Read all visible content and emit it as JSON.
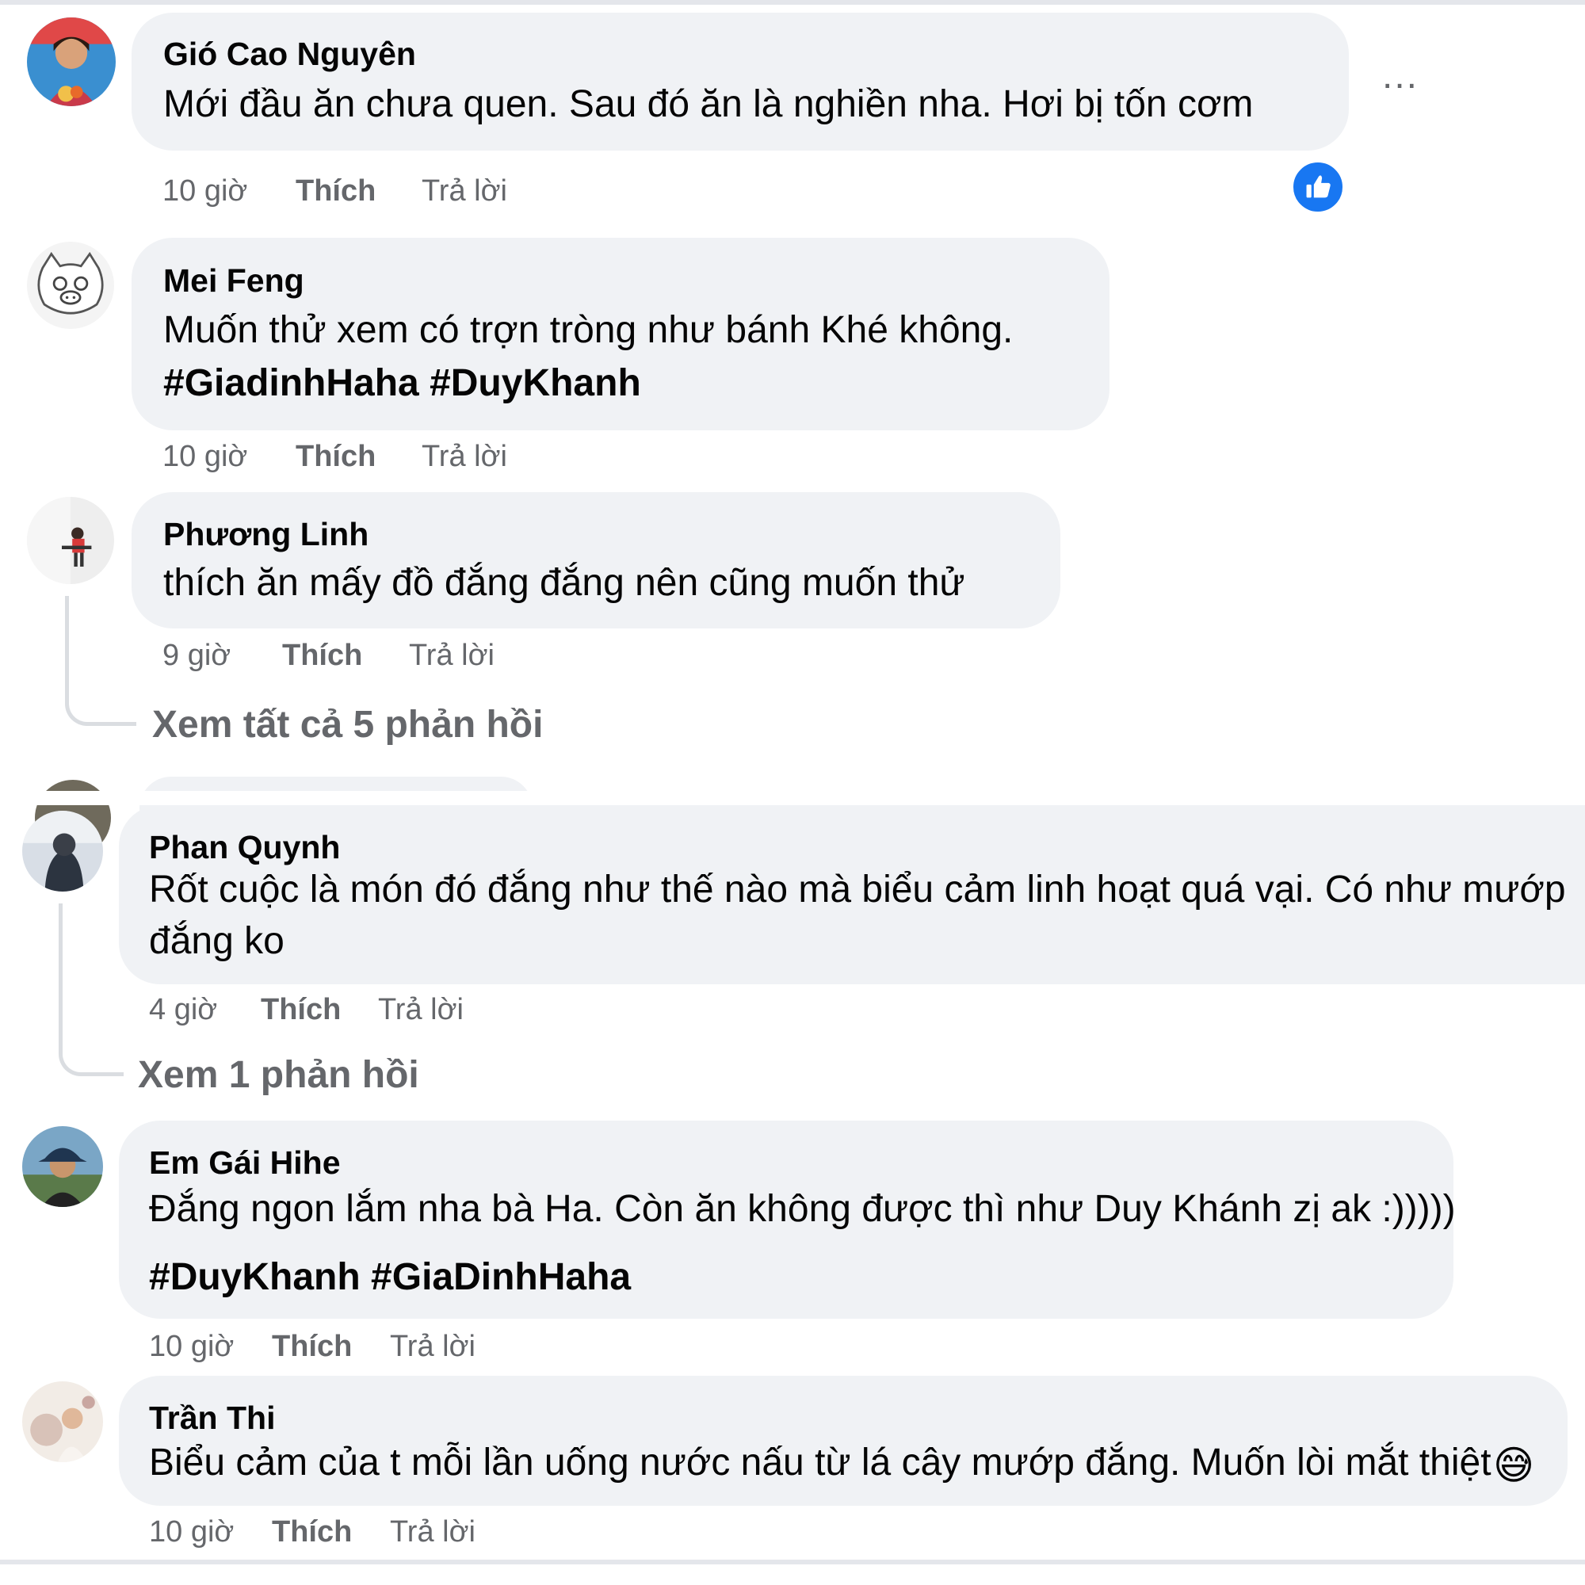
{
  "comments": [
    {
      "author": "Gió Cao Nguyên",
      "text": "Mới đầu ăn chưa quen. Sau đó ăn là nghiền nha. Hơi bị tốn cơm",
      "time": "10 giờ",
      "like_label": "Thích",
      "reply_label": "Trả lời",
      "reaction": "like-icon"
    },
    {
      "author": "Mei Feng",
      "text": "Muốn thử xem có trợn tròng như bánh Khé không.",
      "hashtags": "#GiadinhHaha #DuyKhanh",
      "time": "10 giờ",
      "like_label": "Thích",
      "reply_label": "Trả lời"
    },
    {
      "author": "Phương Linh",
      "text": "thích ăn mấy đồ đắng đắng nên cũng muốn thử",
      "time": "9 giờ",
      "like_label": "Thích",
      "reply_label": "Trả lời",
      "view_replies": "Xem tất cả 5 phản hồi"
    },
    {
      "author": "Phan Quynh",
      "text_line1": "Rốt cuộc là món đó đắng như thế nào mà biểu cảm linh hoạt quá vại. Có như mướp",
      "text_line2": "đắng ko",
      "time": "4 giờ",
      "like_label": "Thích",
      "reply_label": "Trả lời",
      "view_replies": "Xem 1 phản hồi"
    },
    {
      "author": "Em Gái Hihe",
      "text": "Đắng ngon lắm nha bà Ha. Còn ăn không được thì như Duy Khánh zị ak :)))))",
      "hashtags": "#DuyKhanh #GiaDinhHaha",
      "time": "10 giờ",
      "like_label": "Thích",
      "reply_label": "Trả lời"
    },
    {
      "author": "Trần Thi",
      "text": "Biểu cảm của t mỗi lần uống nước nấu từ lá cây mướp đắng. Muốn lòi mắt thiệt",
      "emoji": "😅",
      "time": "10 giờ",
      "like_label": "Thích",
      "reply_label": "Trả lời"
    }
  ],
  "more_options": "..."
}
